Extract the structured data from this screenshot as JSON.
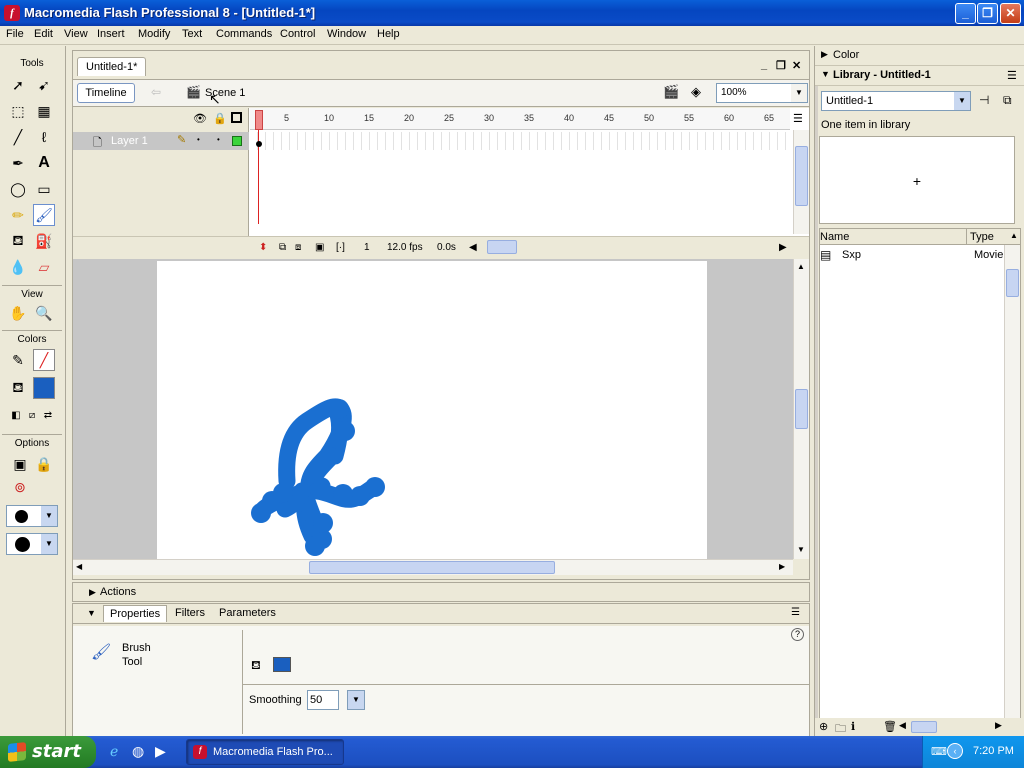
{
  "window": {
    "title": "Macromedia Flash Professional 8 - [Untitled-1*]",
    "app_icon_letter": "f"
  },
  "menu": [
    "File",
    "Edit",
    "View",
    "Insert",
    "Modify",
    "Text",
    "Commands",
    "Control",
    "Window",
    "Help"
  ],
  "tools": {
    "heading": "Tools",
    "view_heading": "View",
    "colors_heading": "Colors",
    "options_heading": "Options"
  },
  "document": {
    "tab": "Untitled-1*",
    "timeline_button": "Timeline",
    "scene": "Scene 1",
    "zoom": "100%",
    "layer_name": "Layer 1",
    "frame_numbers": [
      "1",
      "5",
      "10",
      "15",
      "20",
      "25",
      "30",
      "35",
      "40",
      "45",
      "50",
      "55",
      "60",
      "65"
    ],
    "current_frame": "1",
    "fps": "12.0 fps",
    "elapsed": "0.0s",
    "brush_color": "#1a6fd1"
  },
  "panels": {
    "actions": "Actions",
    "tabs": [
      "Properties",
      "Filters",
      "Parameters"
    ],
    "tool_name_line1": "Brush",
    "tool_name_line2": "Tool",
    "smoothing_label": "Smoothing",
    "smoothing_value": "50",
    "fill_color": "#1a5fbf"
  },
  "library": {
    "color_header": "Color",
    "header": "Library - Untitled-1",
    "selected_doc": "Untitled-1",
    "count_text": "One item in library",
    "columns": [
      "Name",
      "Type"
    ],
    "items": [
      {
        "name": "Sxp",
        "type": "Movie c"
      }
    ]
  },
  "taskbar": {
    "start": "start",
    "task_label": "Macromedia Flash Pro...",
    "clock": "7:20 PM"
  }
}
